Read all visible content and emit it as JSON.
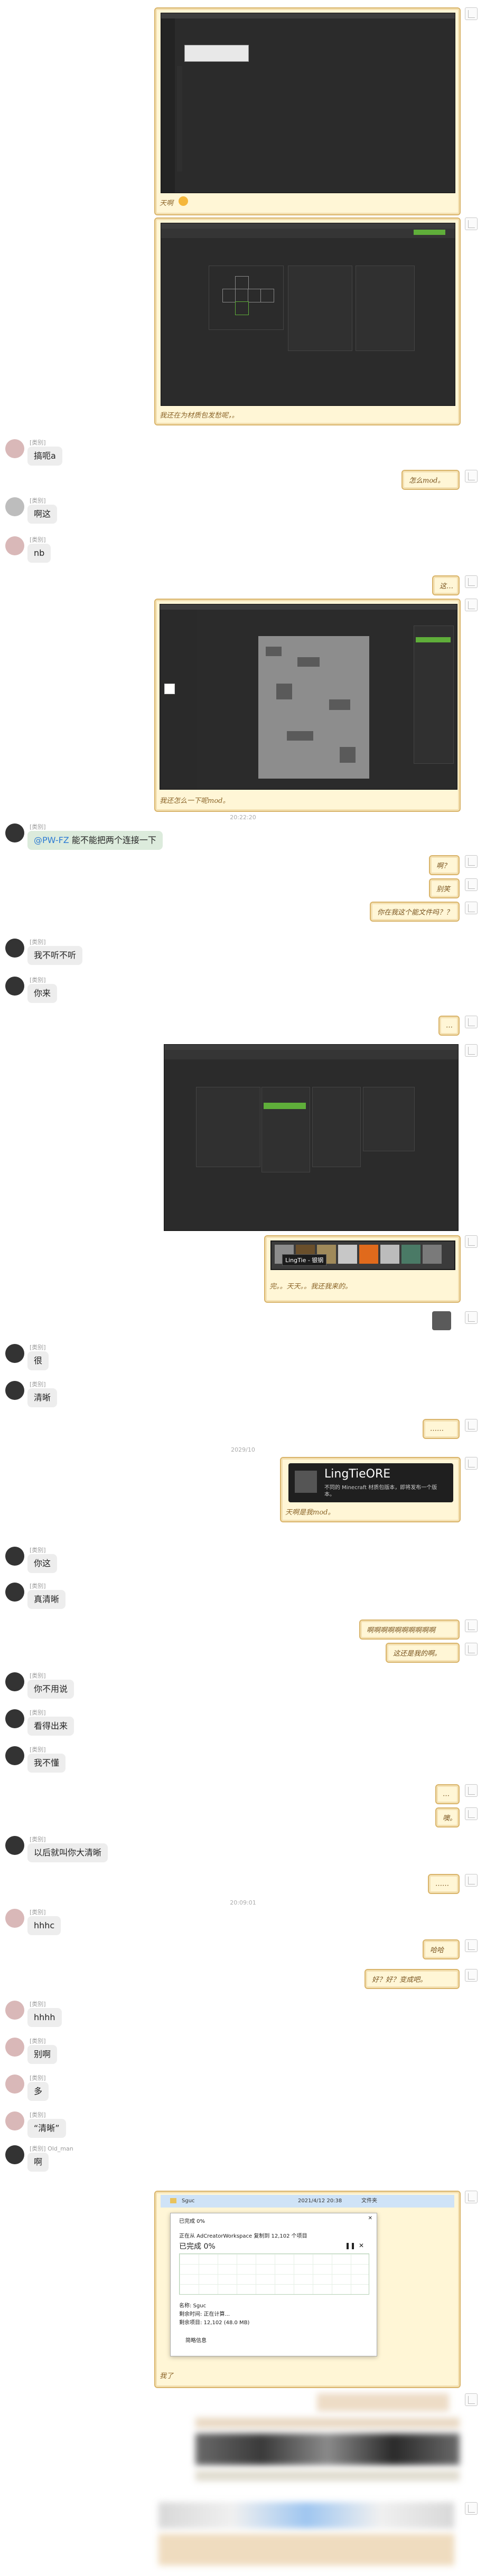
{
  "timestamps": [
    "20:22:20",
    "2029/10",
    "20:09:01"
  ],
  "mentions": {
    "at": "@PW-FZ"
  },
  "others": {
    "name_prefix": "[类别]",
    "name_prefix_alt": "[类别] Old_man",
    "messages": [
      "搞呃a",
      "啊这",
      "nb",
      " 能不能把两个连接一下",
      "我不听不听",
      "你来",
      "很",
      "清晰",
      "你这",
      "真清晰",
      "你不用说",
      "看得出来",
      "我不懂",
      "以后就叫你大清晰",
      "hhhc",
      "hhhh",
      "别啊",
      "多",
      "“清晰”",
      "啊"
    ]
  },
  "mine": {
    "captions": [
      "天啊",
      "我还在为材质包发愁呢，。",
      "怎么mod。",
      "这…",
      "我还怎么一下呢mod。",
      "啊？",
      "别笑",
      "你在我这个能文件吗？？",
      "…",
      "完。。天天。。我还我来的。",
      "……",
      "天啊是我mod。",
      "啊啊啊啊啊啊啊啊啊啊",
      "这还是我的啊。",
      "…",
      "噢。",
      "……",
      "哈哈",
      "好？好？变成吧。",
      "我了"
    ],
    "tooltip_title": "LingTieORE",
    "tooltip_sub": "LingTie - 银钢",
    "tooltip_desc": "不同的 Minecraft 材质包版本，即将发布一个版本。",
    "file_dialog": {
      "title": "已完成 0%",
      "from_to": "正在从 AdCreatorWorkspace 复制到 12,102 个项目",
      "percent": "已完成 0%",
      "name": "名称: Sguc",
      "remaining": "剩余时间: 正在计算...",
      "items": "剩余项目: 12,102 (48.0 MB)",
      "less": "简略信息",
      "folder": "Sguc",
      "date": "2021/4/12 20:38",
      "kind": "文件夹"
    }
  },
  "colors": {
    "scroll_bg": "#fff6d6",
    "scroll_border": "#d9b46a",
    "bubble_bg": "#ededed",
    "accent": "#2d7bd4",
    "mc_green": "#5fae3a"
  }
}
